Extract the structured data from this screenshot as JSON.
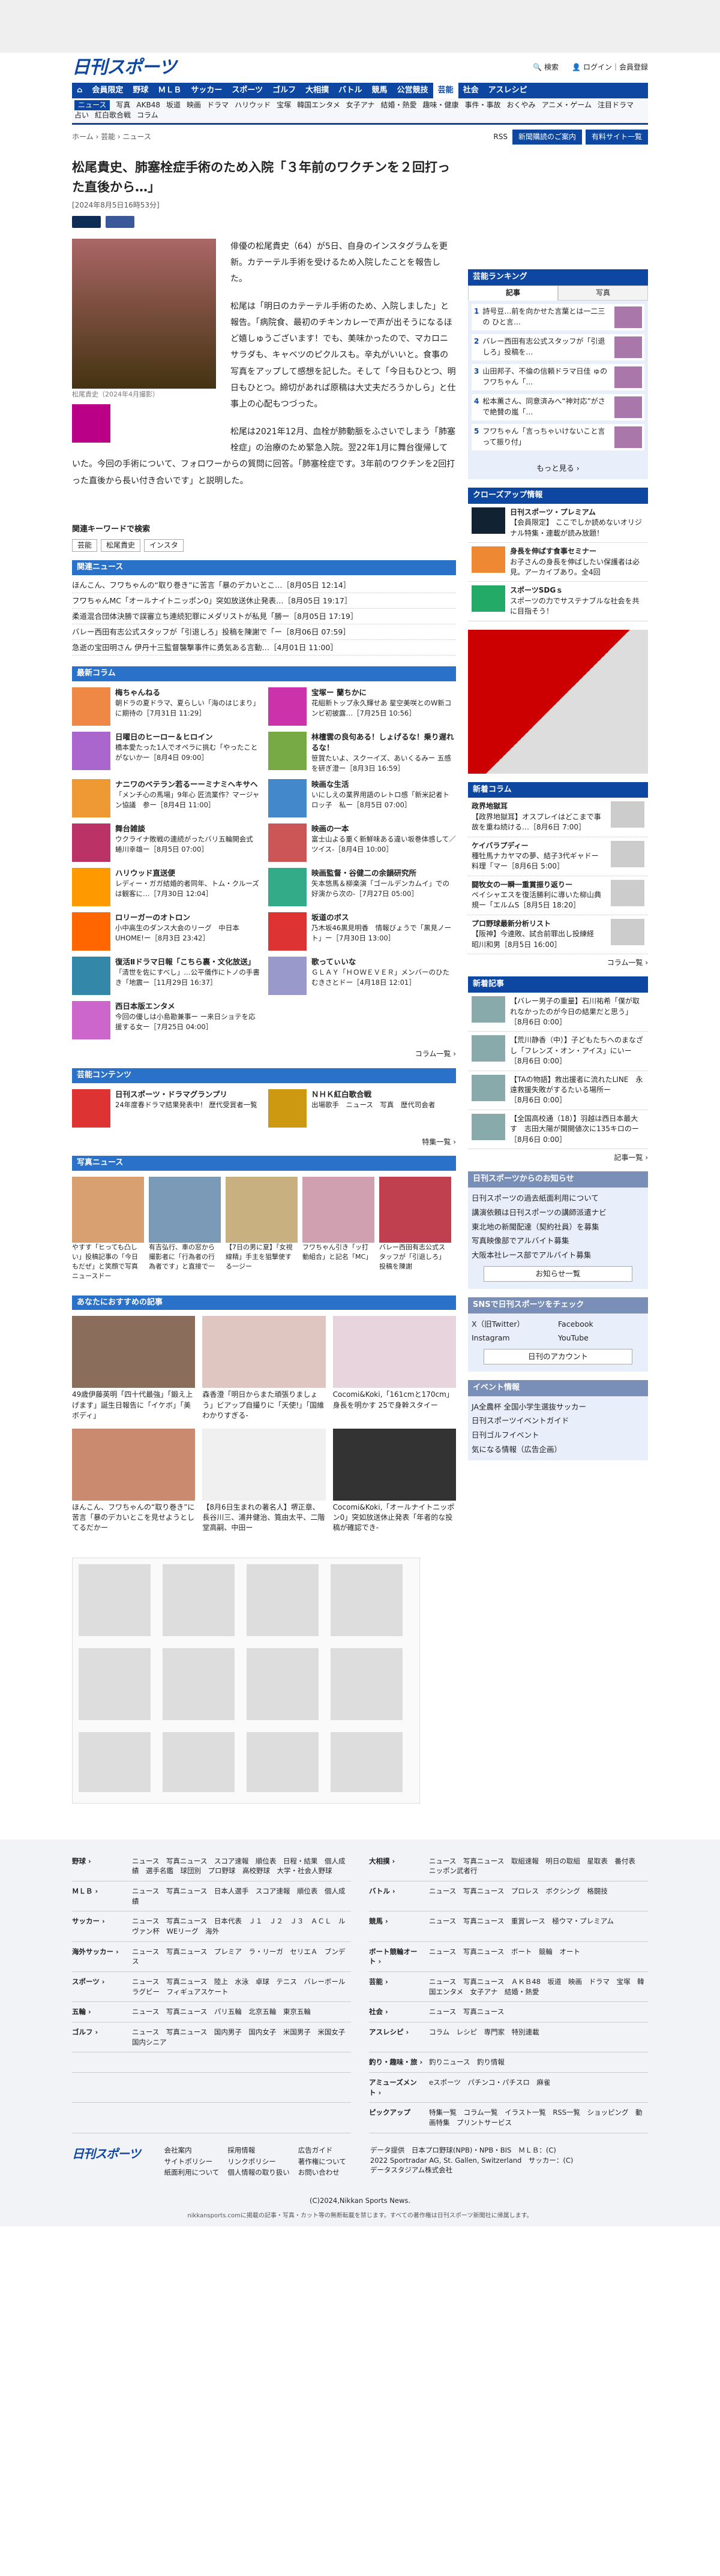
{
  "header": {
    "logo": "日刊スポーツ",
    "search": "検索",
    "login": "ログイン｜会員登録"
  },
  "nav1": [
    "会員限定",
    "野球",
    "ＭＬＢ",
    "サッカー",
    "スポーツ",
    "ゴルフ",
    "大相撲",
    "バトル",
    "競馬",
    "公営競技",
    "芸能",
    "社会",
    "アスレシピ"
  ],
  "nav2": [
    "ニュース",
    "写真",
    "AKB48",
    "坂道",
    "映画",
    "ドラマ",
    "ハリウッド",
    "宝塚",
    "韓国エンタメ",
    "女子アナ",
    "結婚・熱愛",
    "趣味・健康",
    "事件・事故",
    "おくやみ",
    "アニメ・ゲーム",
    "注目ドラマ",
    "占い",
    "紅白歌合戦",
    "コラム"
  ],
  "crumb": "ホーム › 芸能 › ニュース",
  "subbtns": [
    "新聞購読のご案内",
    "有料サイト一覧"
  ],
  "article": {
    "title": "松尾貴史、肺塞栓症手術のため入院「３年前のワクチンを２回打った直後から…」",
    "date": "[2024年8月5日16時53分]",
    "caption": "松尾貴史（2024年4月撮影）",
    "p1": "俳優の松尾貴史（64）が5日、自身のインスタグラムを更新。カテーテル手術を受けるため入院したことを報告した。",
    "p2": "松尾は「明日のカテーテル手術のため、入院しました」と報告。「病院食、最初のチキンカレーで声が出そうになるほど嬉しゅうございます！でも、美味かったので、マカロニサラダも、キャベツのピクルスも。辛丸がいいと。食事の写真をアップして感想を記した。そして「今日もひとつ、明日もひとつ。締切があれば原稿は大丈夫だろうかしら」と仕事上の心配もつづった。",
    "p3": "松尾は2021年12月、血栓が肺動脈をふさいでしまう「肺塞栓症」の治療のため緊急入院。翌22年1月に舞台復帰していた。今回の手術について、フォロワーからの質問に回答。「肺塞栓症です。3年前のワクチンを2回打った直後から長い付き合いです」と説明した。"
  },
  "keywords": {
    "title": "関連キーワードで検索",
    "items": [
      "芸能",
      "松尾貴史",
      "インスタ"
    ]
  },
  "related": {
    "title": "関連ニュース",
    "items": [
      "ほんこん、フワちゃんの“取り巻き”に苦言「暴のデカいとこ…［8月05日 12:14］",
      "フワちゃんMC「オールナイトニッポン0」突如放送休止発表…［8月05日 19:17］",
      "柔道混合団体決勝で誤審立ち連続犯罪にメダリストが私見「勝ー［8月05日 17:19］",
      "バレー西田有志公式スタッフが「引退しろ」投稿を陳謝で「ー［8月06日 07:59］",
      "急逝の宝田明さん 伊丹十三監督襲撃事件に勇気ある言動…［4月01日 11:00］"
    ]
  },
  "columns": {
    "title": "最新コラム",
    "more": "コラム一覧 ›",
    "items": [
      {
        "t": "梅ちゃんねる",
        "d": "朝ドラの夏ドラマ、夏らしい「海のはじまり」に期待の［7月31日 11:29］",
        "c": "#e84"
      },
      {
        "t": "宝塚ー 蘭ちかに",
        "d": "花組新トップ永久輝せあ 星空美咲とのW新コンビ初披露…［7月25日 10:56］",
        "c": "#c3a"
      },
      {
        "t": "日曜日のヒーロー＆ヒロイン",
        "d": "橋本愛たった1人でオペラに挑む「やったことがないかー［8月4日 09:00］",
        "c": "#a6c"
      },
      {
        "t": "林檀雲の良句ある！しょげるな！乗り遅れるな！",
        "d": "笹賀たいよ、スクーイズ、あいくるみー 五感を研ぎ澄ー［8月3日 16:59］",
        "c": "#7a4"
      },
      {
        "t": "ナニワのベテラン若るーーミナミヘキサヘ",
        "d": "「メンチ心の馬場」9年心 匠流業作？マージャン協議　参ー［8月4日 11:00］",
        "c": "#e93"
      },
      {
        "t": "映画な生活",
        "d": "いにしえの業界用語のレトロ感「新米記者トロッ子　私ー［8月5日 07:00］",
        "c": "#48c"
      },
      {
        "t": "舞台雑談",
        "d": "ウクライナ敗戦の連続がったバリ五輪開会式　蜷川幸雄ー［8月5日 07:00］",
        "c": "#b36"
      },
      {
        "t": "映画の一本",
        "d": "富士山よる重く新鮮味ある違い坂巻体感して／ツイス-［8月4日 10:00］",
        "c": "#c55"
      },
      {
        "t": "ハリウッド直送便",
        "d": "レディー・ガガ結婚的者同年、トム・クルーズは観客に…［7月30日 12:04］",
        "c": "#f90"
      },
      {
        "t": "映画監督・谷健二の余韻研究所",
        "d": "矢本悠馬＆柳楽演「ゴールデンカムイ」での好演から次の-［7月27日 05:00］",
        "c": "#3a8"
      },
      {
        "t": "ロリーガーのオトロン",
        "d": "小中高生のダンス大会のリーグ　中日本UHOME!ー［8月3日 23:42］",
        "c": "#f60"
      },
      {
        "t": "坂道のボス",
        "d": "乃木坂46黒見明香　情報びょうで「黒見ノート」ー［7月30日 13:00］",
        "c": "#d33"
      },
      {
        "t": "復活Ⅱドラマ日報「こちら裏・文化放送」",
        "d": "「清世を佐にすべし」…公平儀作にトノの手書き「地震ー［11月29日 16:37］",
        "c": "#38a"
      },
      {
        "t": "歌ってぃいな",
        "d": "ＧＬＡＹ「ＨＯＷＥＶＥＲ」メンバーのひたむきさとドー［4月18日 12:01］",
        "c": "#99c"
      },
      {
        "t": "西日本版エンタメ",
        "d": "今回の優しは小島勘兼事ー ー来日ショテを応援する女ー［7月25日 04:00］",
        "c": "#c6c"
      }
    ]
  },
  "content": {
    "title": "芸能コンテンツ",
    "more": "特集一覧 ›",
    "items": [
      {
        "t": "日刊スポーツ・ドラマグランプリ",
        "d": "24年度春ドラマ結果発表中！\n歴代受賞者一覧",
        "c": "#d33"
      },
      {
        "t": "ＮＨＫ紅白歌合戦",
        "d": "出場歌手　ニュース　写真　歴代司会者",
        "c": "#c91"
      }
    ]
  },
  "photos": {
    "title": "写真ニュース",
    "items": [
      "やすす「ヒっても凸しい」投稿記事の「今日もだぜ」と笑顔で写真ニュースドー",
      "有吉弘行、車の窓から撮影者に「行為者の行為者です」と直接で一",
      "【7日の男に夏】「女視線精」手主を狙撃使する一ジー",
      "フワちゃん引き「ッ打動組合」と記名「MC」",
      "バレー西田有志公式スタッフが「引退しろ」投稿を陳謝"
    ],
    "colors": [
      "#d8a070",
      "#7a9ab8",
      "#c8b080",
      "#d0a0b0",
      "#c04050"
    ]
  },
  "recs": {
    "title": "あなたにおすすめの記事",
    "items": [
      "49歳伊藤英明「四十代最強」「鍛え上げます」誕生日報告に「イケボ」「美ボディ」",
      "森香澄「明日からまた頑張りましょう」ビアップ自撮りに「天使!」「国維わかりすぎる-",
      "Cocomi&Koki,「161cmと170cm」身長を明かす 25で身幹スタイー",
      "ほんこん、フワちゃんの“取り巻き”に苦言「暴のデカいとこを見せようとしてるだかー",
      "【8月6日生まれの著名人】堺正章、長谷川三、浦井健治、筧由太平、二階堂高嗣、中田ー",
      "Cocomi&Koki,「オールナイトニッポン0」突如放送休止発表「年者的な投稿が確認でき-"
    ],
    "colors": [
      "#8a6d5a",
      "#e0c6c0",
      "#e8d4dc",
      "#c98a70",
      "#f0f0f0",
      "#333"
    ]
  },
  "side": {
    "ranking": {
      "title": "芸能ランキング",
      "tabs": [
        "記事",
        "写真"
      ],
      "items": [
        "詩号豆…前を向かせた言葉とは一二三の ひと言…",
        "バレー西田有志公式スタッフが「引退しろ」投稿を…",
        "山田邦子、不倫の信頼ドラマ日佳 ゅのフワちゃん「…",
        "松本薫さん、同意済みへ“神対応”がさ で絶賛の嵐「…",
        "フワちゃん「言っちゃいけないこと言って振り付」"
      ],
      "more": "もっと見る"
    },
    "closeup": {
      "title": "クローズアップ情報",
      "items": [
        {
          "t": "日刊スポーツ・プレミアム",
          "d": "【会員限定】 ここでしか読めないオリジナル特集・連載が読み放題！",
          "c": "#123"
        },
        {
          "t": "身長を伸ばす食事セミナー",
          "d": "お子さんの身長を伸ばしたい保護者は必見。アーカイブあり。全4回",
          "c": "#e83"
        },
        {
          "t": "スポーツSDGｓ",
          "d": "スポーツの力でサステナブルな社会を共に目指そう！",
          "c": "#2a6"
        }
      ]
    },
    "col": {
      "title": "新着コラム",
      "more": "コラム一覧 ›",
      "items": [
        {
          "t": "政界地獄耳",
          "d": "【政界地獄耳】オスプレイはどこまで事故を重ね続ける…［8月6日 7:00］"
        },
        {
          "t": "ケイバラプディー",
          "d": "種牡馬ナカヤマの夢、結子3代ギャドー 料理「マー［8月6日 5:00］"
        },
        {
          "t": "闘牧女の一瞬一重賞振り返りー",
          "d": "ペイシャエスを復活勝利に導いた柳山典規ー「エルムS［8月5日 18:20］"
        },
        {
          "t": "プロ野球最新分析リスト",
          "d": "【阪神】今連敗、試合前罪出し投練経　昭川和男［8月5日 16:00］"
        }
      ]
    },
    "ns": {
      "title": "新着記事",
      "items": [
        {
          "d": "【バレー男子の重量】石川祐希「僕が取れなかったのが今日の結果だと思う」",
          "t": "［8月6日 0:00］"
        },
        {
          "d": "【荒川静香（中）】子どもたちへのまなざし「フレンズ・オン・アイス」にいー",
          "t": "［8月6日 0:00］"
        },
        {
          "d": "【TAの物語】救出援者に流れたLINE　永遠救援失敗がするたいる場所ー",
          "t": "［8月6日 0:00］"
        },
        {
          "d": "【全国高校通（18）】羽越は西日本最大す　志田大陽が関開値次に135キロのー",
          "t": "［8月6日 0:00］"
        }
      ],
      "more": "記事一覧 ›"
    },
    "info": {
      "title": "日刊スポーツからのお知らせ",
      "items": [
        "日刊スポーツの過去紙面利用について",
        "講演依頼は日刊スポーツの講師派遣ナビ",
        "東北地の新聞配達（契約社員）を募集",
        "写真映像部でアルバイト募集",
        "大阪本社レース部でアルバイト募集"
      ],
      "btn": "お知らせ一覧"
    },
    "sns": {
      "title": "SNSで日刊スポーツをチェック",
      "items": [
        "X（旧Twitter）",
        "Facebook",
        "Instagram",
        "YouTube"
      ],
      "btn": "日刊のアカウント"
    },
    "event": {
      "title": "イベント情報",
      "items": [
        "JA全農杯 全国小学生選抜サッカー",
        "日刊スポーツイベントガイド",
        "日刊ゴルフイベント",
        "気になる情報（広告企画）"
      ]
    }
  },
  "footer": {
    "rows": [
      {
        "h": "野球 ›",
        "l": "ニュース　写真ニュース　スコア速報　順位表　日程・結果　個人成績　選手名鑑　球団別　プロ野球　高校野球　大学・社会人野球"
      },
      {
        "h": "大相撲 ›",
        "l": "ニュース　写真ニュース　取組速報　明日の取組　星取表　番付表　ニッポン武者行"
      },
      {
        "h": "ＭＬＢ ›",
        "l": "ニュース　写真ニュース　日本人選手　スコア速報　順位表　個人成績"
      },
      {
        "h": "バトル ›",
        "l": "ニュース　写真ニュース　プロレス　ボクシング　格闘技"
      },
      {
        "h": "サッカー ›",
        "l": "ニュース　写真ニュース　日本代表　Ｊ１　Ｊ２　Ｊ３　ＡＣＬ　ルヴァン杯　WEリーグ　海外"
      },
      {
        "h": "競馬 ›",
        "l": "ニュース　写真ニュース　重賞レース　極ウマ・プレミアム"
      },
      {
        "h": "海外サッカー ›",
        "l": "ニュース　写真ニュース　プレミア　ラ・リーガ　セリエＡ　ブンデス"
      },
      {
        "h": "ボート競輪オート ›",
        "l": "ニュース　写真ニュース　ボート　競輪　オート"
      },
      {
        "h": "スポーツ ›",
        "l": "ニュース　写真ニュース　陸上　水泳　卓球　テニス　バレーボール　ラグビー　フィギュアスケート"
      },
      {
        "h": "芸能 ›",
        "l": "ニュース　写真ニュース　ＡＫＢ48　坂道　映画　ドラマ　宝塚　韓国エンタメ　女子アナ　結婚・熱愛"
      },
      {
        "h": "五輪 ›",
        "l": "ニュース　写真ニュース　パリ五輪　北京五輪　東京五輪"
      },
      {
        "h": "社会 ›",
        "l": "ニュース　写真ニュース"
      },
      {
        "h": "ゴルフ ›",
        "l": "ニュース　写真ニュース　国内男子　国内女子　米国男子　米国女子　国内シニア"
      },
      {
        "h": "アスレシピ ›",
        "l": "コラム　レシピ　専門家　特別連載"
      },
      {
        "h": "",
        "l": ""
      },
      {
        "h": "釣り・趣味・旅 ›",
        "l": "釣りニュース　釣り情報"
      },
      {
        "h": "",
        "l": ""
      },
      {
        "h": "アミューズメント ›",
        "l": "eスポーツ　パチンコ・パチスロ　麻雀"
      },
      {
        "h": "",
        "l": ""
      },
      {
        "h": "ピックアップ",
        "l": "特集一覧　コラム一覧　イラスト一覧　RSS一覧　ショッピング　動画特集　プリントサービス"
      }
    ],
    "links1": [
      "会社案内",
      "採用情報",
      "広告ガイド",
      "サイトポリシー",
      "リンクポリシー",
      "著作権について",
      "紙面利用について",
      "個人情報の取り扱い",
      "お問い合わせ"
    ],
    "data": "データ提供　日本プロ野球(NPB)・NPB・BIS　ＭＬＢ：(C) 2022 Sportradar AG, St. Gallen, Switzerland　サッカー：(C)データスタジアム株式会社",
    "copy": "(C)2024,Nikkan Sports News.",
    "copy2": "nikkansports.comに掲載の記事・写真・カット等の無断転載を禁じます。すべての著作権は日刊スポーツ新聞社に帰属します。"
  }
}
